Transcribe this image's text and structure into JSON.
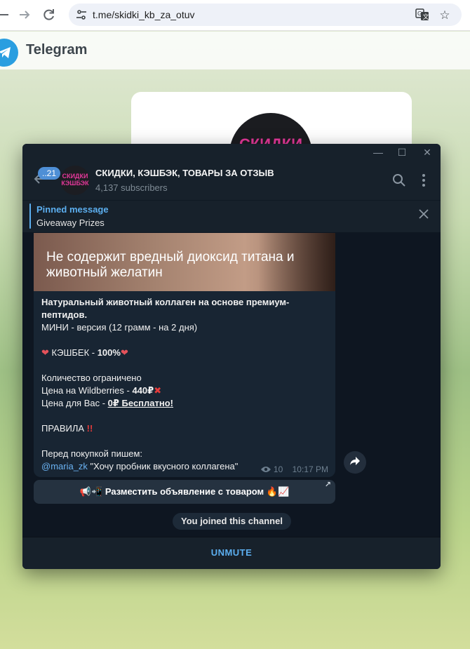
{
  "browser": {
    "back_icon": "arrow-left",
    "forward_icon": "arrow-right",
    "reload_icon": "reload",
    "url": "t.me/skidki_kb_za_otuv"
  },
  "page": {
    "brand": "Telegram",
    "card_avatar_text": "СКИДКИ"
  },
  "window": {
    "minimize": "—",
    "maximize": "☐",
    "close": "✕"
  },
  "chat": {
    "unread_badge": "..21",
    "avatar_text": "СКИДКИ КЭШБЭК",
    "title": "СКИДКИ, КЭШБЭК, ТОВАРЫ ЗА ОТЗЫВ",
    "subscribers": "4,137 subscribers"
  },
  "pinned": {
    "title": "Pinned message",
    "text": "Giveaway Prizes"
  },
  "message": {
    "image_text": "Не содержит вредный диоксид титана и животный желатин",
    "headline": "Натуральный животный коллаген на основе премиум-пептидов.",
    "mini": "МИНИ - версия (12 грамм - на 2 дня)",
    "cashback_label": "КЭШБЕК - ",
    "cashback_value": "100%",
    "limited": "Количество ограничено",
    "wb_price_label": "Цена на Wildberries - ",
    "wb_price_value": "440₽",
    "your_price_label": "Цена для Вас - ",
    "your_price_value": "0₽ Бесплатно!",
    "rules": "ПРАВИЛА",
    "before": "Перед покупкой пишем:",
    "mention": "@maria_zk",
    "quote": " \"Хочу пробник вкусного коллагена\"",
    "views": "10",
    "time": "10:17 PM"
  },
  "inline_button": {
    "label": "📢📲 Разместить объявление с товаром 🔥📈"
  },
  "service_message": "You joined this channel",
  "unmute_label": "UNMUTE",
  "colors": {
    "accent": "#5caff0",
    "window_bg": "#0e1621",
    "bubble": "#182533"
  }
}
